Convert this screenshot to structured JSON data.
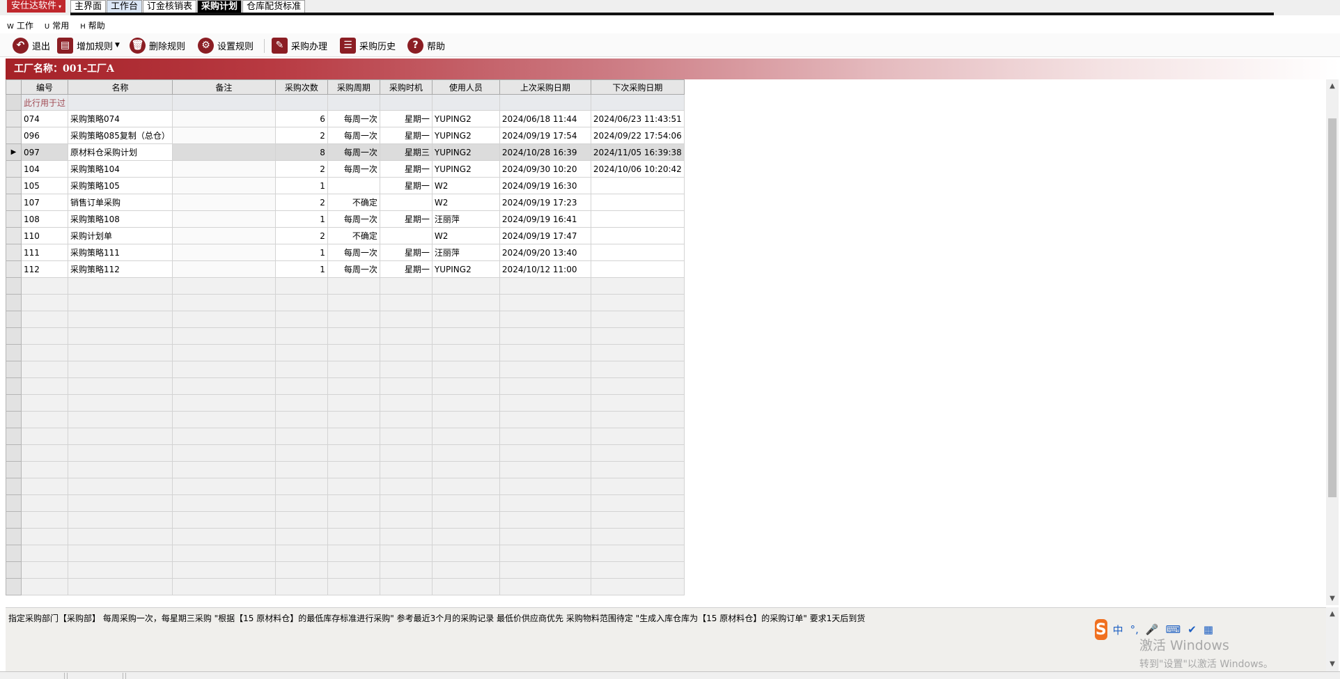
{
  "brand": {
    "label": "安仕达软件"
  },
  "tabs": [
    {
      "label": "主界面",
      "style": "normal"
    },
    {
      "label": "工作台",
      "style": "alt"
    },
    {
      "label": "订金核销表",
      "style": "normal"
    },
    {
      "label": "采购计划",
      "style": "active"
    },
    {
      "label": "仓库配货标准",
      "style": "normal"
    }
  ],
  "menu": [
    {
      "key": "W",
      "label": "工作"
    },
    {
      "key": "U",
      "label": "常用"
    },
    {
      "key": "H",
      "label": "帮助"
    }
  ],
  "toolbar": {
    "exit": "退出",
    "add_rule": "增加规则",
    "delete_rule": "删除规则",
    "set_rule": "设置规则",
    "purchase_handle": "采购办理",
    "purchase_history": "采购历史",
    "help": "帮助"
  },
  "factory": {
    "label": "工厂名称：001-工厂A"
  },
  "grid": {
    "headers": [
      "编号",
      "名称",
      "备注",
      "采购次数",
      "采购周期",
      "采购时机",
      "使用人员",
      "上次采购日期",
      "下次采购日期"
    ],
    "filter_hint": "此行用于过",
    "selected_index": 2,
    "rows": [
      {
        "id": "074",
        "name": "采购策略074",
        "memo": "",
        "count": "6",
        "cycle": "每周一次",
        "timing": "星期一",
        "user": "YUPING2",
        "last": "2024/06/18 11:44",
        "next": "2024/06/23 11:43:51"
      },
      {
        "id": "096",
        "name": "采购策略085复制（总仓）",
        "memo": "",
        "count": "2",
        "cycle": "每周一次",
        "timing": "星期一",
        "user": "YUPING2",
        "last": "2024/09/19 17:54",
        "next": "2024/09/22 17:54:06"
      },
      {
        "id": "097",
        "name": "原材料仓采购计划",
        "memo": "",
        "count": "8",
        "cycle": "每周一次",
        "timing": "星期三",
        "user": "YUPING2",
        "last": "2024/10/28 16:39",
        "next": "2024/11/05 16:39:38"
      },
      {
        "id": "104",
        "name": "采购策略104",
        "memo": "",
        "count": "2",
        "cycle": "每周一次",
        "timing": "星期一",
        "user": "YUPING2",
        "last": "2024/09/30 10:20",
        "next": "2024/10/06 10:20:42"
      },
      {
        "id": "105",
        "name": "采购策略105",
        "memo": "",
        "count": "1",
        "cycle": "",
        "timing": "星期一",
        "user": "W2",
        "last": "2024/09/19 16:30",
        "next": ""
      },
      {
        "id": "107",
        "name": "销售订单采购",
        "memo": "",
        "count": "2",
        "cycle": "不确定",
        "timing": "",
        "user": "W2",
        "last": "2024/09/19 17:23",
        "next": ""
      },
      {
        "id": "108",
        "name": "采购策略108",
        "memo": "",
        "count": "1",
        "cycle": "每周一次",
        "timing": "星期一",
        "user": "汪丽萍",
        "last": "2024/09/19 16:41",
        "next": ""
      },
      {
        "id": "110",
        "name": "采购计划单",
        "memo": "",
        "count": "2",
        "cycle": "不确定",
        "timing": "",
        "user": "W2",
        "last": "2024/09/19 17:47",
        "next": ""
      },
      {
        "id": "111",
        "name": "采购策略111",
        "memo": "",
        "count": "1",
        "cycle": "每周一次",
        "timing": "星期一",
        "user": "汪丽萍",
        "last": "2024/09/20 13:40",
        "next": ""
      },
      {
        "id": "112",
        "name": "采购策略112",
        "memo": "",
        "count": "1",
        "cycle": "每周一次",
        "timing": "星期一",
        "user": "YUPING2",
        "last": "2024/10/12 11:00",
        "next": ""
      }
    ]
  },
  "description": "指定采购部门【采购部】 每周采购一次，每星期三采购 \"根据【15  原材料仓】的最低库存标准进行采购\" 参考最近3个月的采购记录 最低价供应商优先 采购物料范围待定 \"生成入库仓库为【15 原材料仓】的采购订单\" 要求1天后到货",
  "ime": {
    "logo": "S",
    "mode": "中",
    "punct": "°,"
  },
  "watermark": {
    "line1": "激活 Windows",
    "line2": "转到\"设置\"以激活 Windows。"
  },
  "icons": {
    "exit": "undo-arrow-icon",
    "add_rule": "document-add-icon",
    "delete_rule": "trash-icon",
    "set_rule": "gear-icon",
    "purchase_handle": "edit-document-icon",
    "purchase_history": "list-icon",
    "help": "question-icon"
  },
  "colors": {
    "brand": "#c0282d",
    "header_gradient_start": "#a52127",
    "icon": "#8b1e24"
  }
}
